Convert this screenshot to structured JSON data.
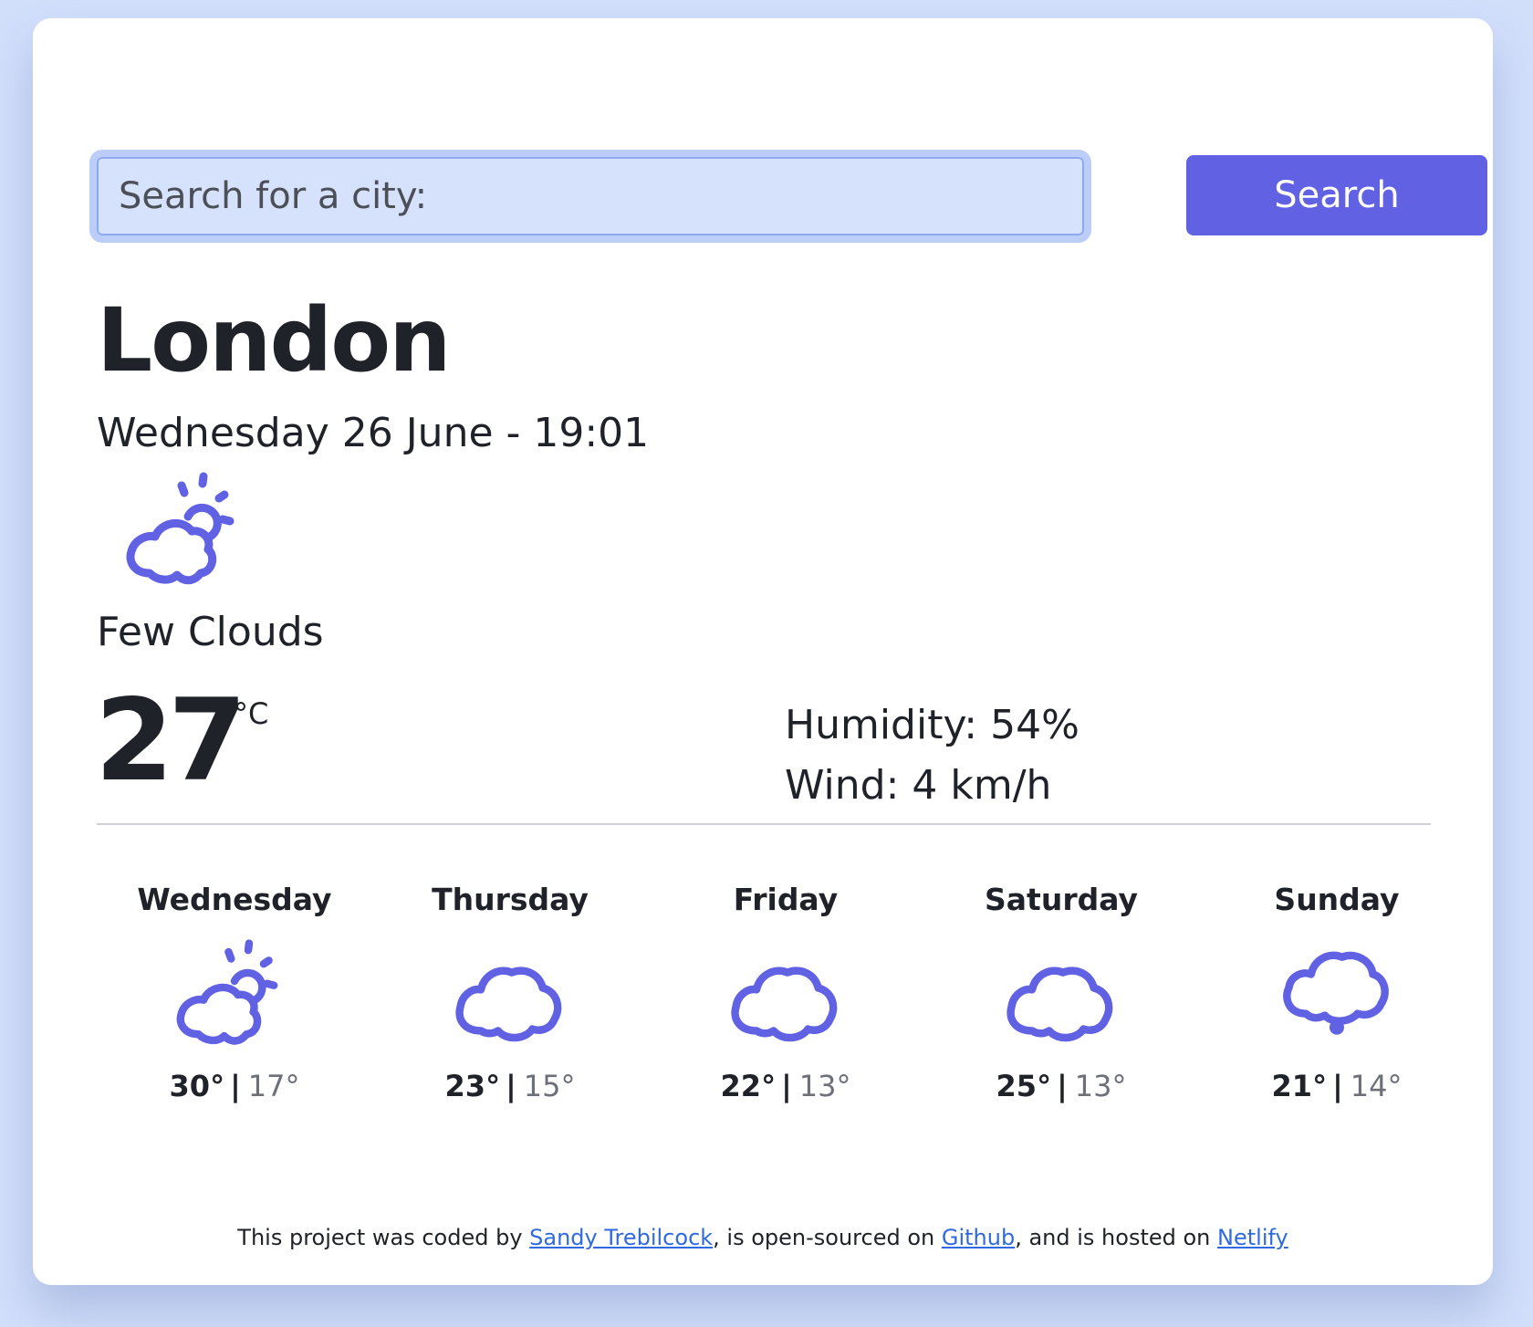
{
  "search": {
    "placeholder": "Search for a city:",
    "value": "",
    "button_label": "Search"
  },
  "current": {
    "city": "London",
    "datetime": "Wednesday 26 June - 19:01",
    "icon": "few-clouds-icon",
    "description": "Few Clouds",
    "temperature": "27",
    "unit": "°C",
    "humidity": "Humidity: 54%",
    "wind": "Wind: 4 km/h"
  },
  "forecast": [
    {
      "day": "Wednesday",
      "icon": "few-clouds-icon",
      "max": "30°",
      "min": "17°"
    },
    {
      "day": "Thursday",
      "icon": "cloud-icon",
      "max": "23°",
      "min": "15°"
    },
    {
      "day": "Friday",
      "icon": "cloud-icon",
      "max": "22°",
      "min": "13°"
    },
    {
      "day": "Saturday",
      "icon": "cloud-icon",
      "max": "25°",
      "min": "13°"
    },
    {
      "day": "Sunday",
      "icon": "cloud-drop-icon",
      "max": "21°",
      "min": "14°"
    }
  ],
  "separator": "|",
  "footer": {
    "text_1": "This project was coded by ",
    "author_link": "Sandy Trebilcock",
    "text_2": ", is open-sourced on ",
    "github_link": "Github",
    "text_3": ", and is hosted on ",
    "netlify_link": "Netlify"
  },
  "colors": {
    "accent": "#6161e3",
    "icon": "#6161e3",
    "background": "#d2dffb",
    "link": "#2f6ae0"
  }
}
